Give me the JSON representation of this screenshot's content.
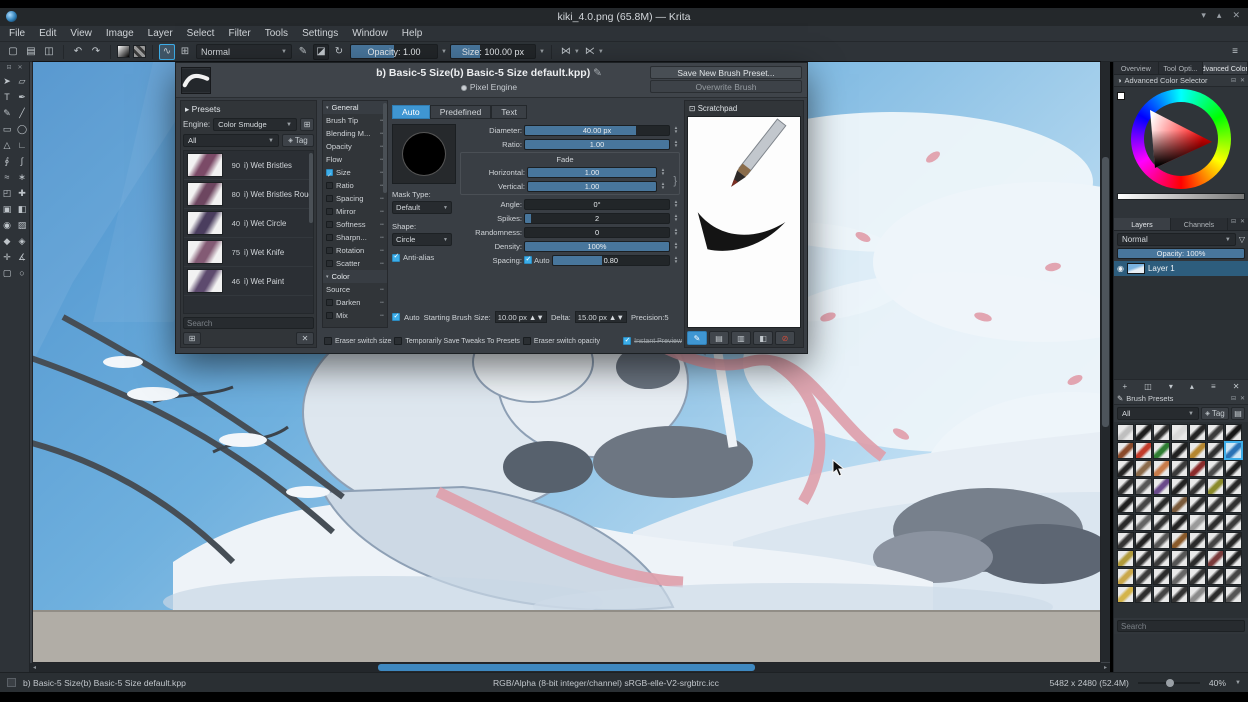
{
  "window": {
    "title": "kiki_4.0.png (65.8M) — Krita",
    "minimize": "▾",
    "maximize": "▴",
    "close": "✕"
  },
  "menu": {
    "items": [
      "File",
      "Edit",
      "View",
      "Image",
      "Layer",
      "Select",
      "Filter",
      "Tools",
      "Settings",
      "Window",
      "Help"
    ]
  },
  "toolbar": {
    "file_icons": [
      {
        "name": "new-document-icon",
        "glyph": "▢"
      },
      {
        "name": "open-document-icon",
        "glyph": "▤"
      },
      {
        "name": "save-document-icon",
        "glyph": "◫"
      }
    ],
    "edit_icons": [
      {
        "name": "undo-icon",
        "glyph": "↶"
      },
      {
        "name": "redo-icon",
        "glyph": "↷"
      }
    ],
    "brush_icons": [
      {
        "name": "choose-brush-preset-icon",
        "glyph": "∿",
        "cls": "active"
      },
      {
        "name": "brush-presets-grid-icon",
        "glyph": "⊞",
        "cls": ""
      }
    ],
    "blend_mode": "Normal",
    "mode_icons": [
      {
        "name": "edit-brush-settings-icon",
        "glyph": "✎",
        "cls": ""
      },
      {
        "name": "eraser-mode-icon",
        "glyph": "◪",
        "cls": "pressed"
      },
      {
        "name": "reload-preset-icon",
        "glyph": "↻",
        "cls": ""
      }
    ],
    "opacity": {
      "label": "Opacity: 1.00",
      "fill": 50
    },
    "size": {
      "label": "Size: 100.00 px",
      "fill": 35
    },
    "mirror_icons": [
      {
        "name": "mirror-horizontal-icon",
        "glyph": "⋈"
      },
      {
        "name": "mirror-vertical-icon",
        "glyph": "⋉"
      }
    ],
    "overflow_icon": "≡"
  },
  "toolbox": {
    "head_icons": [
      "⊟",
      "✕"
    ],
    "tools": [
      {
        "name": "select-shapes-tool",
        "glyph": "➤"
      },
      {
        "name": "edit-shapes-tool",
        "glyph": "▱"
      },
      {
        "name": "text-tool",
        "glyph": "T"
      },
      {
        "name": "calligraphy-tool",
        "glyph": "✒"
      },
      {
        "name": "freehand-brush-tool",
        "glyph": "✎"
      },
      {
        "name": "line-tool",
        "glyph": "╱"
      },
      {
        "name": "rectangle-tool",
        "glyph": "▭"
      },
      {
        "name": "ellipse-tool",
        "glyph": "◯"
      },
      {
        "name": "polygon-tool",
        "glyph": "△"
      },
      {
        "name": "polyline-tool",
        "glyph": "∟"
      },
      {
        "name": "bezier-curve-tool",
        "glyph": "∮"
      },
      {
        "name": "freehand-path-tool",
        "glyph": "∫"
      },
      {
        "name": "dynamic-brush-tool",
        "glyph": "≈"
      },
      {
        "name": "multibrush-tool",
        "glyph": "∗"
      },
      {
        "name": "transform-tool",
        "glyph": "◰"
      },
      {
        "name": "move-tool",
        "glyph": "✚"
      },
      {
        "name": "crop-tool",
        "glyph": "▣"
      },
      {
        "name": "gradient-tool",
        "glyph": "◧"
      },
      {
        "name": "color-sampler-tool",
        "glyph": "◉"
      },
      {
        "name": "pattern-tool",
        "glyph": "▨"
      },
      {
        "name": "fill-tool",
        "glyph": "◆"
      },
      {
        "name": "smart-patch-tool",
        "glyph": "◈"
      },
      {
        "name": "assistants-tool",
        "glyph": "✛"
      },
      {
        "name": "measure-tool",
        "glyph": "∡"
      },
      {
        "name": "rect-select-tool",
        "glyph": "▢"
      },
      {
        "name": "ellipse-select-tool",
        "glyph": "○"
      }
    ]
  },
  "dialog": {
    "title": "b) Basic-5 Size(b) Basic-5 Size default.kpp)",
    "edit_icon": "✎",
    "engine_badge": "Pixel Engine",
    "save_button": "Save New Brush Preset...",
    "overwrite_button": "Overwrite Brush",
    "presets": {
      "header": "Presets",
      "expander": "▸",
      "engine_label": "Engine:",
      "engine_value": "Color Smudge",
      "filter_value": "All",
      "tag_button": "Tag",
      "search_placeholder": "Search",
      "brushes": [
        {
          "num": "90",
          "name": "i) Wet Bristles",
          "color": "#7b4a67"
        },
        {
          "num": "80",
          "name": "i) Wet Bristles Rough",
          "color": "#6d4660"
        },
        {
          "num": "40",
          "name": "i) Wet Circle",
          "color": "#4a3d5e"
        },
        {
          "num": "75",
          "name": "i) Wet Knife",
          "color": "#835a74"
        },
        {
          "num": "46",
          "name": "i) Wet Paint",
          "color": "#5d4a6e"
        }
      ]
    },
    "options": [
      {
        "label": "General",
        "type": "section"
      },
      {
        "label": "Brush Tip",
        "type": "plain"
      },
      {
        "label": "Blending M...",
        "type": "plain"
      },
      {
        "label": "Opacity",
        "type": "plain"
      },
      {
        "label": "Flow",
        "type": "plain"
      },
      {
        "label": "Size",
        "type": "on"
      },
      {
        "label": "Ratio",
        "type": "off"
      },
      {
        "label": "Spacing",
        "type": "off"
      },
      {
        "label": "Mirror",
        "type": "off"
      },
      {
        "label": "Softness",
        "type": "off"
      },
      {
        "label": "Sharpn...",
        "type": "off"
      },
      {
        "label": "Rotation",
        "type": "off"
      },
      {
        "label": "Scatter",
        "type": "off"
      },
      {
        "label": "Color",
        "type": "section"
      },
      {
        "label": "Source",
        "type": "plain"
      },
      {
        "label": "Darken",
        "type": "off"
      },
      {
        "label": "Mix",
        "type": "off"
      }
    ],
    "tabs": [
      {
        "label": "Auto",
        "cls": "active"
      },
      {
        "label": "Predefined",
        "cls": ""
      },
      {
        "label": "Text",
        "cls": ""
      }
    ],
    "mask_type_label": "Mask Type:",
    "mask_type_value": "Default",
    "shape_label": "Shape:",
    "shape_value": "Circle",
    "antialias_label": "Anti-alias",
    "sliders_top": [
      {
        "label": "Diameter:",
        "value": "40.00 px",
        "fill": "77%"
      },
      {
        "label": "Ratio:",
        "value": "1.00",
        "fill": "100%"
      }
    ],
    "fade": {
      "title": "Fade",
      "h_label": "Horizontal:",
      "h_value": "1.00",
      "h_fill": 100,
      "v_label": "Vertical:",
      "v_value": "1.00",
      "v_fill": 100
    },
    "sliders_bottom": [
      {
        "label": "Angle:",
        "value": "0°",
        "fill": "0%"
      },
      {
        "label": "Spikes:",
        "value": "2",
        "fill": "4%"
      },
      {
        "label": "Randomness:",
        "value": "0",
        "fill": "0%"
      },
      {
        "label": "Density:",
        "value": "100%",
        "fill": "100%"
      }
    ],
    "spacing": {
      "label": "Spacing:",
      "auto_label": "Auto",
      "value": "0.80",
      "fill": 42
    },
    "footer": {
      "auto_label": "Auto",
      "starting_label": "Starting Brush Size:",
      "starting_value": "10.00 px",
      "delta_label": "Delta:",
      "delta_value": "15.00 px",
      "precision_label": "Precision:5",
      "cb1": "Eraser switch size",
      "cb2": "Temporarily Save Tweaks To Presets",
      "cb3": "Eraser switch opacity",
      "instant_preview": "Instant Preview"
    },
    "scratchpad": {
      "title": "Scratchpad",
      "buttons": [
        {
          "name": "scratchpad-paint-button",
          "glyph": "✎",
          "cls": "blue"
        },
        {
          "name": "scratchpad-fill-gradient-button",
          "glyph": "▤",
          "cls": ""
        },
        {
          "name": "scratchpad-fill-background-button",
          "glyph": "▥",
          "cls": ""
        },
        {
          "name": "scratchpad-fill-color-button",
          "glyph": "◧",
          "cls": ""
        },
        {
          "name": "scratchpad-reset-button",
          "glyph": "⊘",
          "cls": "red"
        }
      ]
    }
  },
  "right": {
    "dock_tabs": [
      {
        "label": "Overview",
        "cls": ""
      },
      {
        "label": "Tool Opti...",
        "cls": ""
      },
      {
        "label": "Advanced Color...",
        "cls": "active"
      }
    ],
    "acs": {
      "title": "Advanced Color Selector"
    },
    "layers": {
      "tab_layers": "Layers",
      "tab_channels": "Channels",
      "blend_mode": "Normal",
      "opacity_label": "Opacity: 100%",
      "opacity_fill": 100,
      "layer_name": "Layer 1",
      "buttons": [
        {
          "name": "add-layer-button",
          "glyph": "+"
        },
        {
          "name": "duplicate-layer-button",
          "glyph": "◫"
        },
        {
          "name": "move-layer-down-button",
          "glyph": "▾"
        },
        {
          "name": "move-layer-up-button",
          "glyph": "▴"
        },
        {
          "name": "layer-properties-button",
          "glyph": "≡"
        },
        {
          "name": "delete-layer-button",
          "glyph": "✕"
        }
      ]
    },
    "presets": {
      "title": "Brush Presets",
      "filter_value": "All",
      "tag_button": "Tag",
      "view_icon": "▤",
      "search_placeholder": "Search",
      "grid": {
        "cols": 7,
        "selected": 13,
        "colors": [
          "#bfbfbf",
          "#1c1c1c",
          "#2e2e2e",
          "#d9d9d9",
          "#242424",
          "#3a3a3a",
          "#161616",
          "#8a4a2a",
          "#c23b2a",
          "#2e7d32",
          "#202020",
          "#b5862f",
          "#303030",
          "#2a72b5",
          "#232323",
          "#8a6a4a",
          "#c77b4a",
          "#3a3a3a",
          "#8a2a2a",
          "#4a4a4a",
          "#1e1e1e",
          "#2e2e2e",
          "#565656",
          "#6a4a8a",
          "#222222",
          "#333333",
          "#8a8a2a",
          "#262626",
          "#1e1e1e",
          "#454545",
          "#2a2a2a",
          "#7a5a3a",
          "#2e2e2e",
          "#383838",
          "#303030",
          "#2a2a2a",
          "#646464",
          "#333333",
          "#222222",
          "#9a9a9a",
          "#2e2e2e",
          "#3a3a3a",
          "#333333",
          "#222222",
          "#555555",
          "#8a5a2a",
          "#2a2a2a",
          "#444444",
          "#262626",
          "#b09a3a",
          "#2e2e2e",
          "#3a3a3a",
          "#555555",
          "#2a2a2a",
          "#7a3a3a",
          "#222222",
          "#caa84a",
          "#3a3a3a",
          "#2a2a2a",
          "#666666",
          "#333333",
          "#2e2e2e",
          "#444444",
          "#d4b44a",
          "#2e2e2e",
          "#444444",
          "#333333",
          "#8a8a8a",
          "#2a2a2a",
          "#555555"
        ]
      }
    }
  },
  "status": {
    "brush_name": "b) Basic-5 Size(b) Basic-5 Size default.kpp",
    "color_info": "RGB/Alpha (8-bit integer/channel)  sRGB-elle-V2-srgbtrc.icc",
    "dimensions": "5482 x 2480 (52.4M)",
    "zoom": "40%"
  }
}
